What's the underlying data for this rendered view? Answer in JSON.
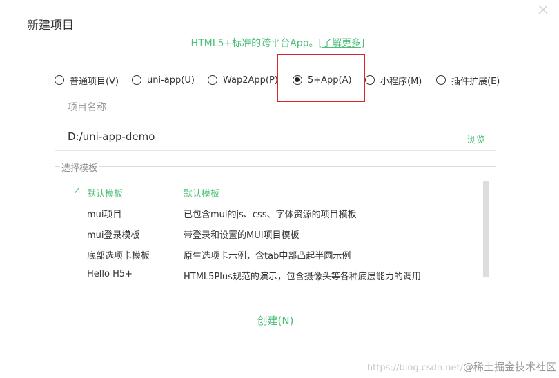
{
  "dialog": {
    "title": "新建项目"
  },
  "subtitle": {
    "text": "HTML5+标准的跨平台App。",
    "link": "[了解更多]"
  },
  "project_types": [
    {
      "label": "普通项目(V)",
      "checked": false
    },
    {
      "label": "uni-app(U)",
      "checked": false
    },
    {
      "label": "Wap2App(P)",
      "checked": false
    },
    {
      "label": "5+App(A)",
      "checked": true
    },
    {
      "label": "小程序(M)",
      "checked": false
    },
    {
      "label": "插件扩展(E)",
      "checked": false
    }
  ],
  "project_name": {
    "value": "",
    "placeholder": "项目名称"
  },
  "project_path": {
    "value": "D:/uni-app-demo",
    "browse_label": "浏览"
  },
  "templates": {
    "legend": "选择模板",
    "items": [
      {
        "name": "默认模板",
        "desc": "默认模板",
        "selected": true
      },
      {
        "name": "mui项目",
        "desc": "已包含mui的js、css、字体资源的项目模板",
        "selected": false
      },
      {
        "name": "mui登录模板",
        "desc": "带登录和设置的MUI项目模板",
        "selected": false
      },
      {
        "name": "底部选项卡模板",
        "desc": "原生选项卡示例，含tab中部凸起半圆示例",
        "selected": false
      },
      {
        "name": "Hello H5+",
        "desc": "HTML5Plus规范的演示，包含摄像头等各种底层能力的调用",
        "selected": false
      }
    ],
    "check_mark": "✓"
  },
  "create_button": {
    "label": "创建(N)"
  },
  "watermark": {
    "url": "https://blog.csdn.net/",
    "brand": "@稀土掘金技术社区"
  },
  "colors": {
    "accent": "#4cbf78",
    "highlight": "#d9262c"
  }
}
